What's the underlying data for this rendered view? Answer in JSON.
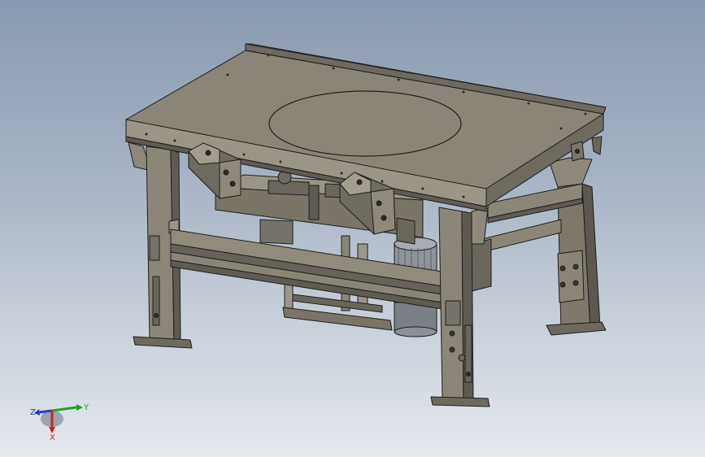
{
  "viewport": {
    "background_top": "#8a9ab0",
    "background_bottom": "#e6e9ee",
    "model_colors": {
      "frame": "#7a7567",
      "frame_light": "#96907f",
      "frame_dark": "#55514a",
      "top_plate": "#8a8577",
      "edge": "#1e1e1e",
      "motor": "#8f949a"
    }
  },
  "triad": {
    "x_label": "X",
    "y_label": "Y",
    "z_label": "Z",
    "x_color": "#d42020",
    "y_color": "#22a022",
    "z_color": "#2040c8"
  }
}
